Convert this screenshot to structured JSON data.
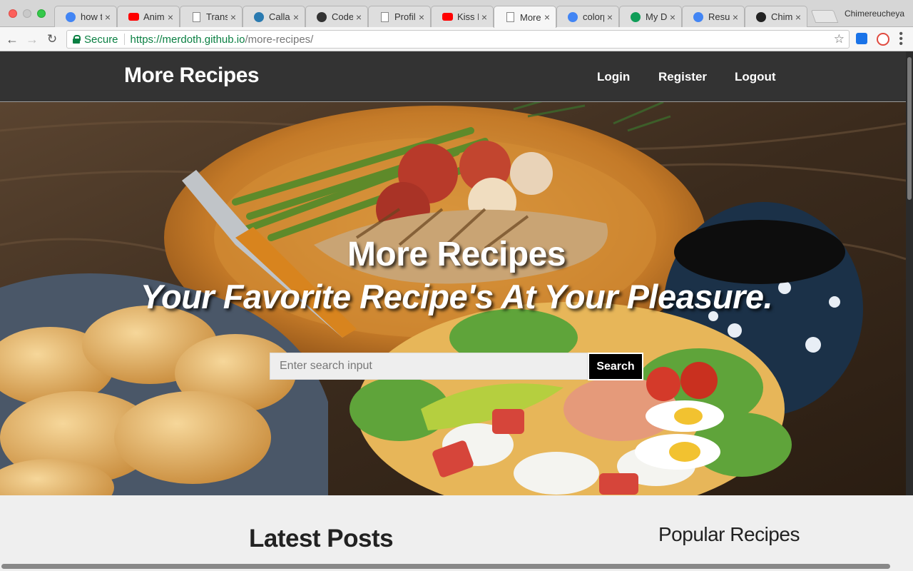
{
  "browser": {
    "tabs": [
      {
        "title": "how t",
        "icon": "google-icon",
        "active": false
      },
      {
        "title": "Anima",
        "icon": "youtube-icon",
        "active": false
      },
      {
        "title": "Trans",
        "icon": "page-icon",
        "active": false
      },
      {
        "title": "Callad",
        "icon": "callad-icon",
        "active": false
      },
      {
        "title": "CodeP",
        "icon": "codepen-icon",
        "active": false
      },
      {
        "title": "Profile",
        "icon": "page-icon",
        "active": false
      },
      {
        "title": "Kiss D",
        "icon": "youtube-icon",
        "active": false
      },
      {
        "title": "More R",
        "icon": "page-icon",
        "active": true
      },
      {
        "title": "colorp",
        "icon": "google-icon",
        "active": false
      },
      {
        "title": "My Dr",
        "icon": "drive-icon",
        "active": false
      },
      {
        "title": "Resum",
        "icon": "docs-icon",
        "active": false
      },
      {
        "title": "Chime",
        "icon": "chime-icon",
        "active": false
      }
    ],
    "profile_name": "Chimereucheya",
    "secure_label": "Secure",
    "url_host": "https://merdoth.github.io",
    "url_path": "/more-recipes/"
  },
  "site": {
    "brand": "More Recipes",
    "nav": {
      "login": "Login",
      "register": "Register",
      "logout": "Logout"
    }
  },
  "hero": {
    "title": "More Recipes",
    "subtitle": "Your Favorite Recipe's At Your Pleasure.",
    "search_placeholder": "Enter search input",
    "search_button": "Search"
  },
  "sections": {
    "latest": "Latest Posts",
    "popular": "Popular Recipes"
  },
  "colors": {
    "navbar": "#333333",
    "page_bg": "#efefef",
    "secure_green": "#0b8043"
  }
}
